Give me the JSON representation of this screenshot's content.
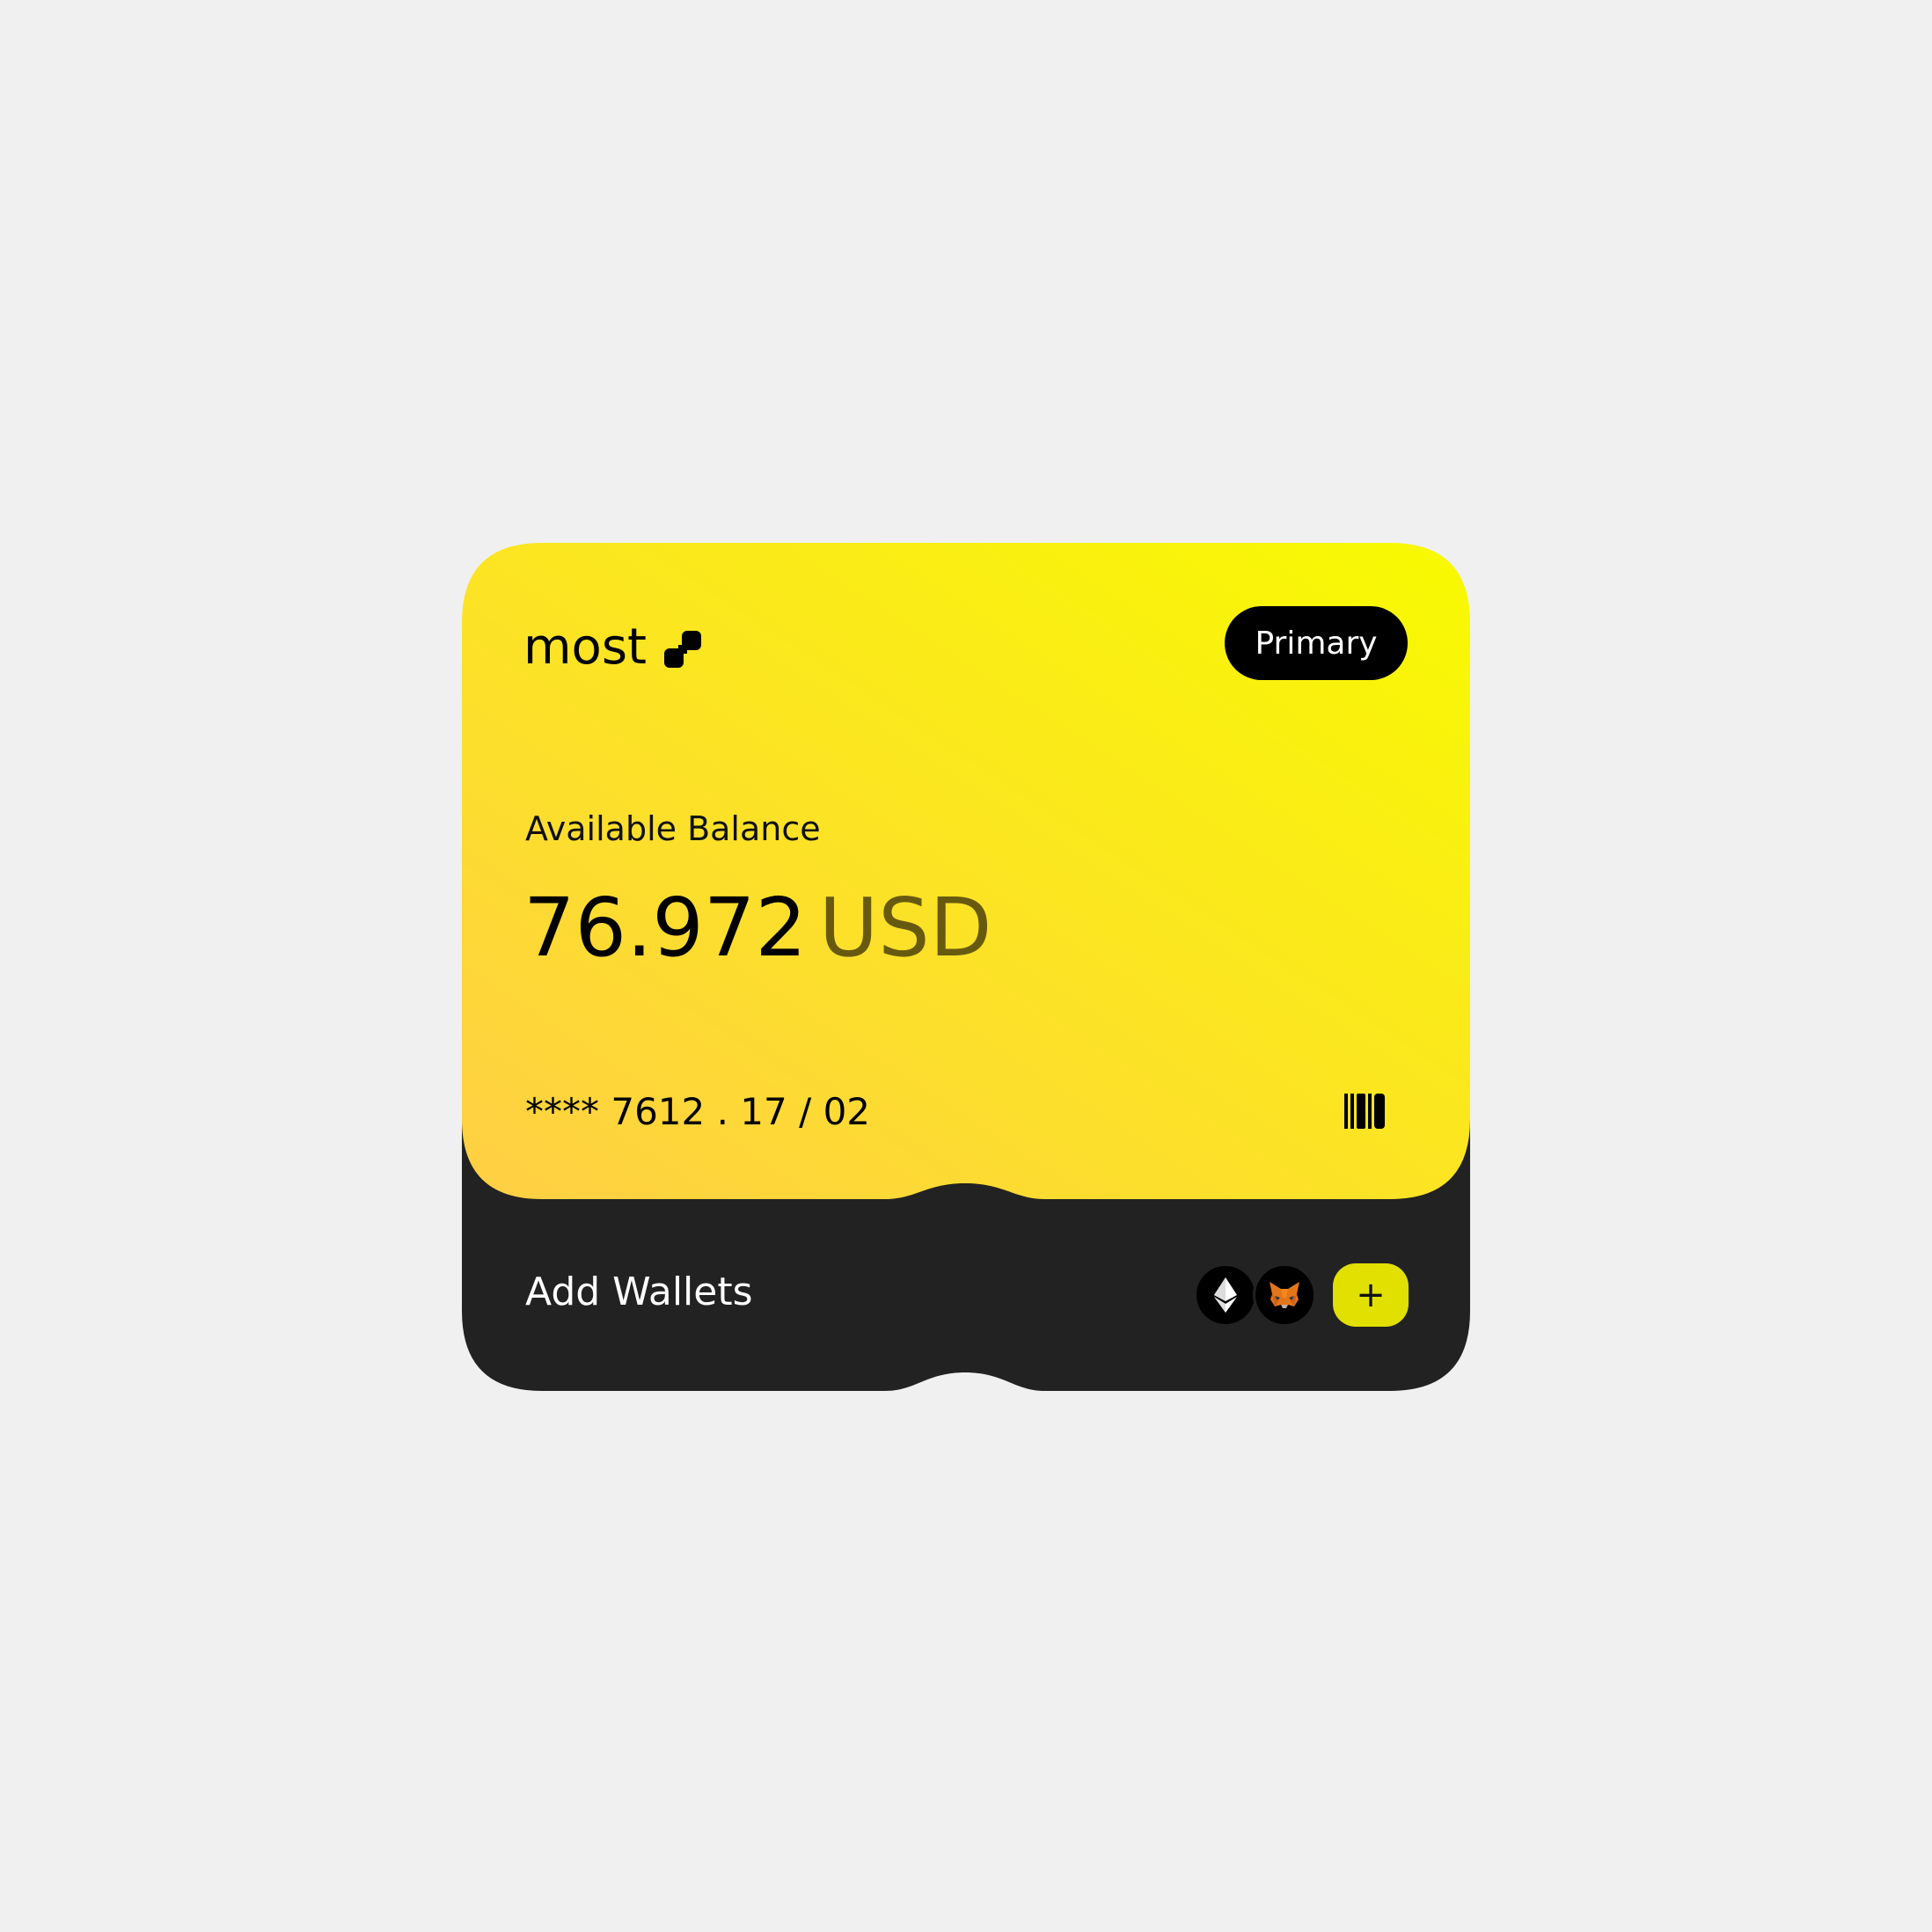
{
  "card": {
    "brand": "most",
    "badge_label": "Primary",
    "balance_label": "Available Balance",
    "balance_amount": "76.972",
    "balance_currency": "USD",
    "card_number": "**** 7612 . 17 / 02",
    "barcode_icon": "barcode-icon",
    "gradient_colors": [
      "#ffcf45",
      "#f8fa00"
    ]
  },
  "wallets": {
    "label": "Add Wallets",
    "icons": [
      "ethereum-icon",
      "metamask-fox-icon"
    ],
    "add_label": "+",
    "add_button_color": "#e2e000",
    "panel_color": "#222222"
  }
}
